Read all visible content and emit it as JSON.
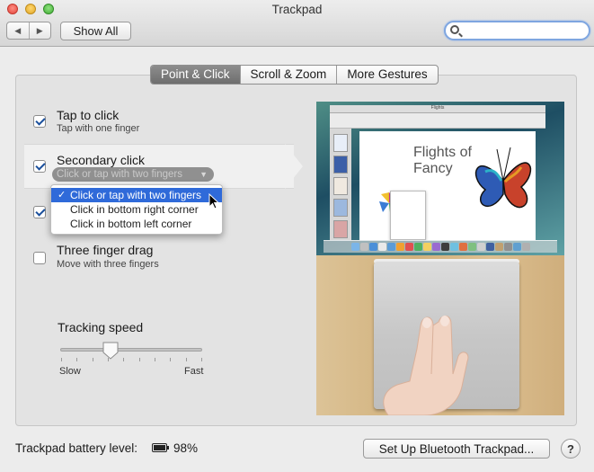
{
  "window": {
    "title": "Trackpad",
    "back_icon": "◀",
    "forward_icon": "▶",
    "show_all_label": "Show All",
    "search_placeholder": ""
  },
  "tabs": [
    {
      "label": "Point & Click",
      "active": true
    },
    {
      "label": "Scroll & Zoom",
      "active": false
    },
    {
      "label": "More Gestures",
      "active": false
    }
  ],
  "options": [
    {
      "title": "Tap to click",
      "subtitle": "Tap with one finger",
      "checked": true
    },
    {
      "title": "Secondary click",
      "subtitle": "Click or tap with two fingers",
      "checked": true
    },
    {
      "title": "",
      "subtitle": "",
      "checked": true
    },
    {
      "title": "Three finger drag",
      "subtitle": "Move with three fingers",
      "checked": false
    }
  ],
  "secondary_click_menu": {
    "selected": "Click or tap with two fingers",
    "items": [
      {
        "label": "Click or tap with two fingers",
        "selected": true
      },
      {
        "label": "Click in bottom right corner",
        "selected": false
      },
      {
        "label": "Click in bottom left corner",
        "selected": false
      }
    ],
    "check_mark": "✓"
  },
  "tracking_speed": {
    "label": "Tracking speed",
    "min_label": "Slow",
    "max_label": "Fast",
    "value_fraction": 0.35,
    "tick_count": 10
  },
  "preview": {
    "doc_title": "Flights of Fancy",
    "window_title": "Flights"
  },
  "footer": {
    "battery_label": "Trackpad battery level:",
    "battery_value": "98%",
    "setup_button": "Set Up Bluetooth Trackpad...",
    "help_label": "?"
  }
}
